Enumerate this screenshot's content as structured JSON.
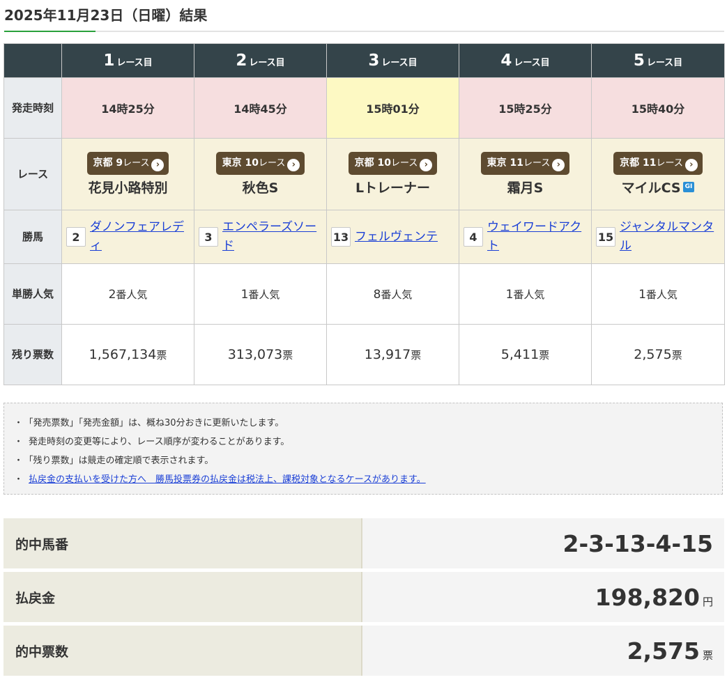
{
  "title": "2025年11月23日（日曜）結果",
  "race_suffix": "レース目",
  "row_labels": {
    "time": "発走時刻",
    "race": "レース",
    "winner": "勝馬",
    "popularity": "単勝人気",
    "remaining": "残り票数"
  },
  "races": [
    {
      "num": "1",
      "time": "14時25分",
      "venue": "京都",
      "race_no": "9",
      "race_unit": "レース",
      "name": "花見小路特別",
      "grade": "",
      "horse_num": "2",
      "horse": "ダノンフェアレディ",
      "pop_num": "2",
      "pop_unit": "番人気",
      "votes": "1,567,134",
      "votes_unit": "票",
      "time_bg": "#f6dedf"
    },
    {
      "num": "2",
      "time": "14時45分",
      "venue": "東京",
      "race_no": "10",
      "race_unit": "レース",
      "name": "秋色S",
      "grade": "",
      "horse_num": "3",
      "horse": "エンペラーズソード",
      "pop_num": "1",
      "pop_unit": "番人気",
      "votes": "313,073",
      "votes_unit": "票",
      "time_bg": "#f6dedf"
    },
    {
      "num": "3",
      "time": "15時01分",
      "venue": "京都",
      "race_no": "10",
      "race_unit": "レース",
      "name": "Lトレーナー",
      "grade": "",
      "horse_num": "13",
      "horse": "フェルヴェンテ",
      "pop_num": "8",
      "pop_unit": "番人気",
      "votes": "13,917",
      "votes_unit": "票",
      "time_bg": "#fdf9c3"
    },
    {
      "num": "4",
      "time": "15時25分",
      "venue": "東京",
      "race_no": "11",
      "race_unit": "レース",
      "name": "霜月S",
      "grade": "",
      "horse_num": "4",
      "horse": "ウェイワードアクト",
      "pop_num": "1",
      "pop_unit": "番人気",
      "votes": "5,411",
      "votes_unit": "票",
      "time_bg": "#f6dedf"
    },
    {
      "num": "5",
      "time": "15時40分",
      "venue": "京都",
      "race_no": "11",
      "race_unit": "レース",
      "name": "マイルCS",
      "grade": "GI",
      "horse_num": "15",
      "horse": "ジャンタルマンタル",
      "pop_num": "1",
      "pop_unit": "番人気",
      "votes": "2,575",
      "votes_unit": "票",
      "time_bg": "#f6dedf"
    }
  ],
  "notes": [
    "「発売票数」「発売金額」は、概ね30分おきに更新いたします。",
    "発走時刻の変更等により、レース順序が変わることがあります。",
    "「残り票数」は競走の確定順で表示されます。"
  ],
  "note_link": "払戻金の支払いを受けた方へ　勝馬投票券の払戻金は税法上、課税対象となるケースがあります。",
  "note_bullet": "・",
  "chevron": "›",
  "results": {
    "hit_numbers": {
      "label": "的中馬番",
      "value": "2-3-13-4-15"
    },
    "payout": {
      "label": "払戻金",
      "value": "198,820",
      "unit": "円"
    },
    "hit_votes": {
      "label": "的中票数",
      "value": "2,575",
      "unit": "票"
    }
  }
}
